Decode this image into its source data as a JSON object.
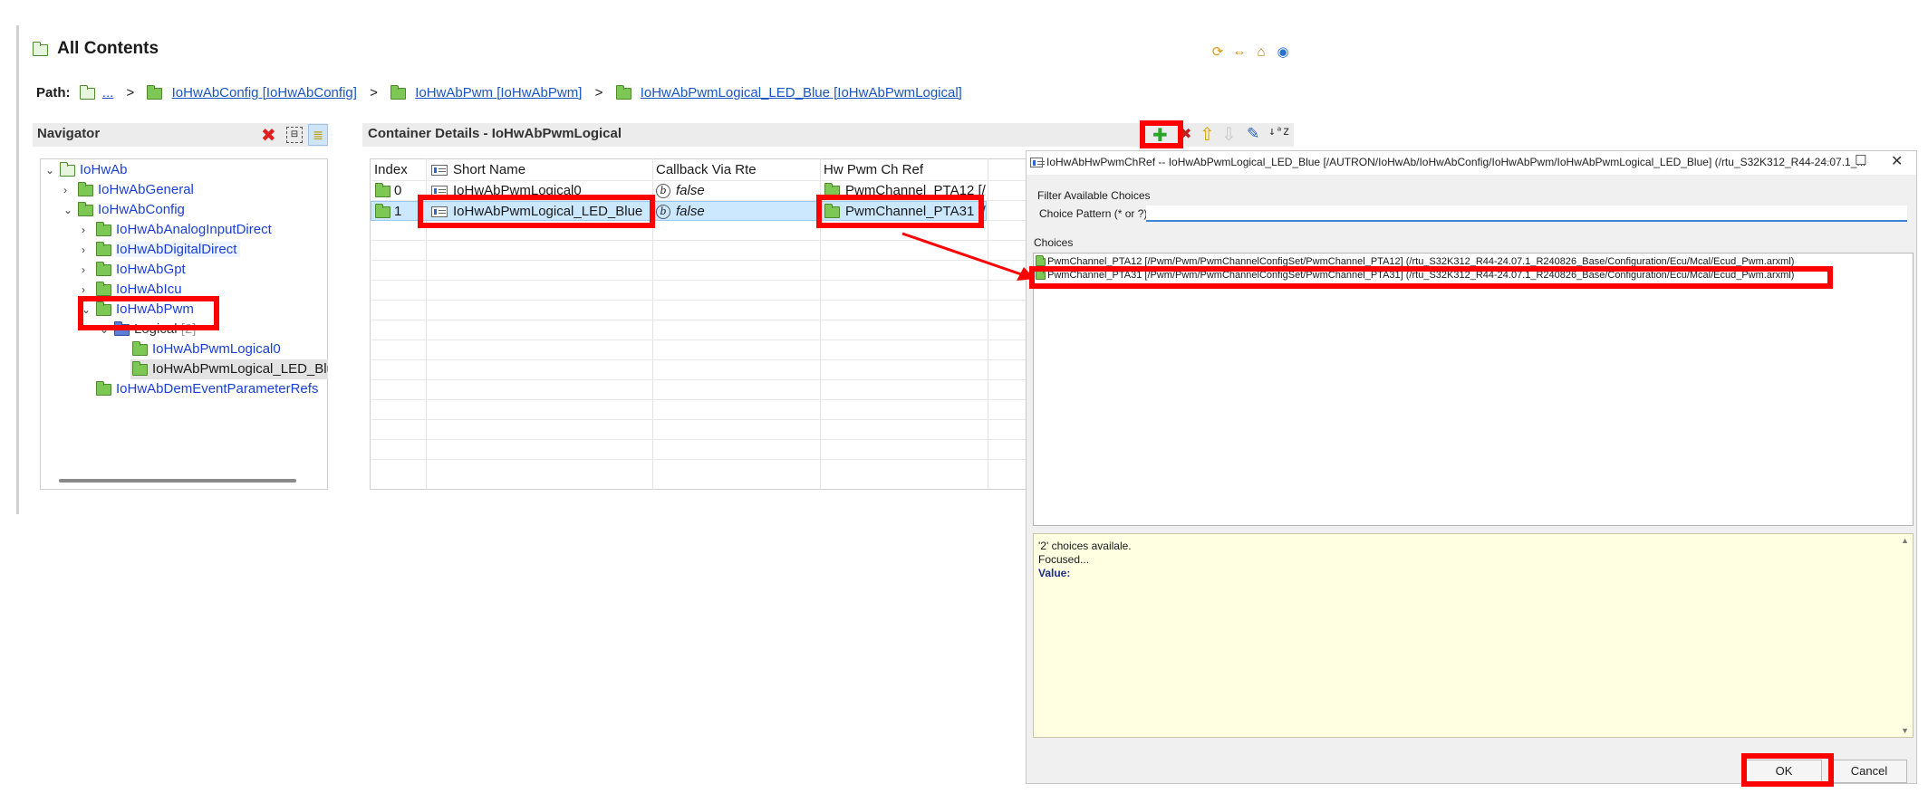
{
  "page": {
    "title": "All Contents",
    "path_label": "Path:",
    "path_ellipsis": "...",
    "breadcrumbs": [
      "IoHwAbConfig [IoHwAbConfig]",
      "IoHwAbPwm [IoHwAbPwm]",
      "IoHwAbPwmLogical_LED_Blue [IoHwAbPwmLogical]"
    ],
    "separator": ">"
  },
  "navigator": {
    "title": "Navigator",
    "tree": [
      {
        "label": "IoHwAb",
        "chev": "⌄"
      },
      {
        "label": "IoHwAbGeneral",
        "chev": "›"
      },
      {
        "label": "IoHwAbConfig",
        "chev": "⌄"
      },
      {
        "label": "IoHwAbAnalogInputDirect",
        "chev": "›"
      },
      {
        "label": "IoHwAbDigitalDirect",
        "chev": "›"
      },
      {
        "label": "IoHwAbGpt",
        "chev": "›"
      },
      {
        "label": "IoHwAbIcu",
        "chev": "›"
      },
      {
        "label": "IoHwAbPwm",
        "chev": "⌄"
      },
      {
        "label": "Logical",
        "count": "[2]",
        "chev": "⌄"
      },
      {
        "label": "IoHwAbPwmLogical0",
        "chev": ""
      },
      {
        "label": "IoHwAbPwmLogical_LED_Blu",
        "chev": ""
      },
      {
        "label": "IoHwAbDemEventParameterRefs",
        "chev": ""
      }
    ]
  },
  "container": {
    "title": "Container Details - IoHwAbPwmLogical",
    "columns": [
      "Index",
      "Short Name",
      "Callback Via Rte",
      "Hw Pwm Ch Ref"
    ],
    "rows": [
      {
        "index": "0",
        "short_name": "IoHwAbPwmLogical0",
        "callback": "false",
        "hw_ref": "PwmChannel_PTA12 [/"
      },
      {
        "index": "1",
        "short_name": "IoHwAbPwmLogical_LED_Blue",
        "callback": "false",
        "hw_ref": "PwmChannel_PTA31 [/"
      }
    ]
  },
  "dialog": {
    "title": "IoHwAbHwPwmChRef -- IoHwAbPwmLogical_LED_Blue [/AUTRON/IoHwAb/IoHwAbConfig/IoHwAbPwm/IoHwAbPwmLogical_LED_Blue] (/rtu_S32K312_R44-24.07.1_...",
    "filter_label": "Filter Available Choices",
    "pattern_label": "Choice Pattern (* or ?)",
    "pattern_value": "",
    "choices_label": "Choices",
    "choices": [
      "PwmChannel_PTA12 [/Pwm/Pwm/PwmChannelConfigSet/PwmChannel_PTA12] (/rtu_S32K312_R44-24.07.1_R240826_Base/Configuration/Ecu/Mcal/Ecud_Pwm.arxml)",
      "PwmChannel_PTA31 [/Pwm/Pwm/PwmChannelConfigSet/PwmChannel_PTA31] (/rtu_S32K312_R44-24.07.1_R240826_Base/Configuration/Ecu/Mcal/Ecud_Pwm.arxml)"
    ],
    "info_line1": "'2' choices availale.",
    "info_line2": "Focused...",
    "info_value_label": "Value:",
    "ok_label": "OK",
    "cancel_label": "Cancel",
    "min_glyph": "—",
    "max_glyph": "☐",
    "close_glyph": "✕"
  },
  "colors": {
    "highlight": "#ff0000",
    "link": "#1a55c4",
    "tree_text": "#1a3fd6",
    "selection": "#cce8ff",
    "info_bg": "#ffffe1"
  }
}
